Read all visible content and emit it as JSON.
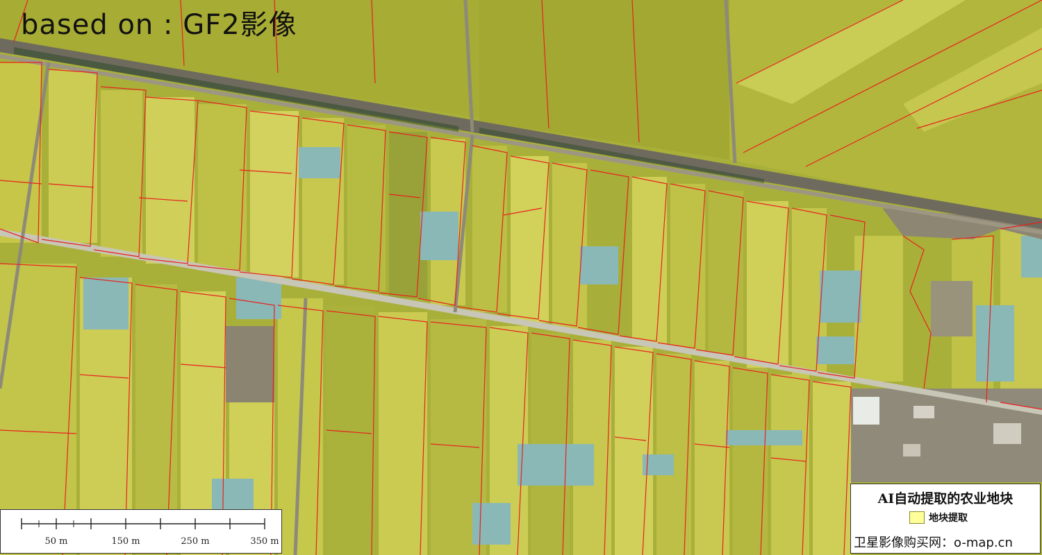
{
  "source_label": "based on : GF2影像",
  "scale_bar": {
    "tick_labels": [
      "50 m",
      "150 m",
      "250 m",
      "350 m"
    ]
  },
  "legend": {
    "title": "AI自动提取的农业地块",
    "item_label": "地块提取",
    "footer": "卫星影像购买网：o-map.cn"
  },
  "colors": {
    "field_boundary": "#e8201e",
    "legend_swatch": "#ffff99",
    "crop_yellow": "#c8c83c",
    "crop_green": "#9aaa30",
    "greenhouse": "#86b4b4",
    "road": "#8a8070"
  }
}
